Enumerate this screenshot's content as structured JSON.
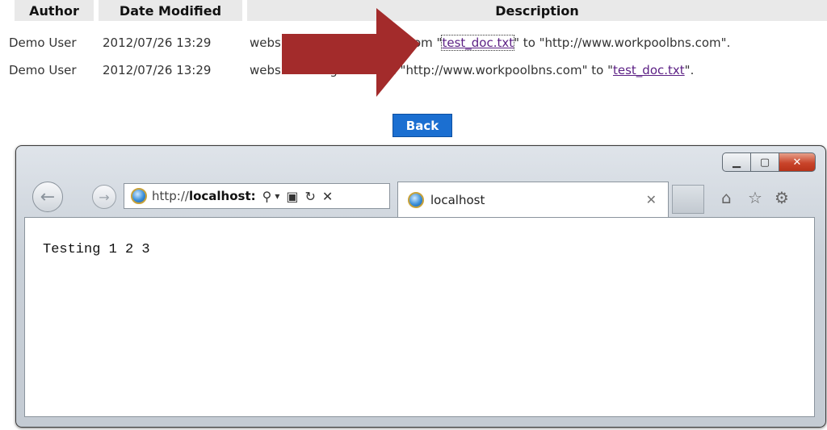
{
  "history": {
    "headers": {
      "author": "Author",
      "date": "Date Modified",
      "description": "Description"
    },
    "rows": [
      {
        "author": "Demo User",
        "date": "2012/07/26 13:29",
        "desc_prefix": "website",
        "desc_partial": "om \"",
        "link": "test_doc.txt",
        "desc_suffix": "\" to \"http://www.workpoolbns.com\"."
      },
      {
        "author": "Demo User",
        "date": "2012/07/26 13:29",
        "desc_prefix": "website changed",
        "desc_partial": "om \"http://www.workpoolbns.com\" to \"",
        "link": "test_doc.txt",
        "desc_suffix": "\"."
      }
    ]
  },
  "back_label": "Back",
  "annotation_color": "#a32b2b",
  "browser": {
    "address": {
      "url_light": "http://",
      "url_bold": "localhost:",
      "search_icon": "⚲",
      "dropdown_icon": "▾",
      "compat_icon": "▣",
      "refresh_icon": "↻",
      "stop_icon": "✕"
    },
    "tab": {
      "title": "localhost",
      "close_icon": "✕"
    },
    "window_controls": {
      "min": "▁",
      "max": "▢",
      "close": "✕"
    },
    "icons": {
      "home": "⌂",
      "favorites": "☆",
      "tools": "⚙",
      "back": "←",
      "forward": "→"
    },
    "content_text": "Testing 1 2 3"
  }
}
